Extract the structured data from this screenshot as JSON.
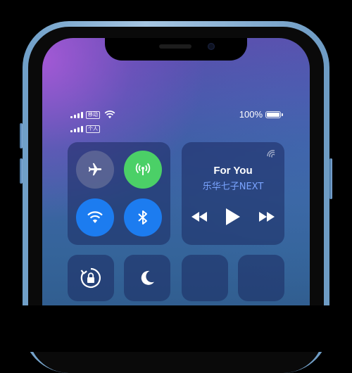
{
  "status_bar": {
    "carrier_1": "移动",
    "carrier_2": "个人",
    "battery_pct": "100%",
    "battery_level": 1.0
  },
  "control_center": {
    "connectivity": {
      "airplane_icon": "airplane-icon",
      "cellular_icon": "cellular-antenna-icon",
      "wifi_icon": "wifi-icon",
      "bluetooth_icon": "bluetooth-icon"
    },
    "now_playing": {
      "title": "For You",
      "artist": "乐华七子NEXT",
      "airplay_icon": "airplay-icon",
      "prev_icon": "rewind-icon",
      "play_icon": "play-icon",
      "next_icon": "fast-forward-icon"
    },
    "tiles": {
      "rotation_lock_icon": "rotation-lock-icon",
      "do_not_disturb_icon": "moon-icon"
    }
  },
  "colors": {
    "cellular_on": "#4bd067",
    "wifi_on": "#1c7cf0",
    "bluetooth_on": "#1c7cf0",
    "artist_text": "#7aa4ff"
  }
}
